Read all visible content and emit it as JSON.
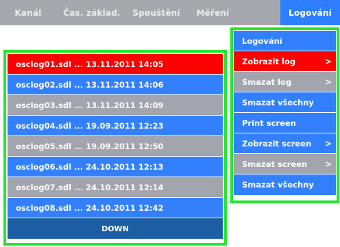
{
  "tabs": [
    {
      "label": "Kanál",
      "active": false
    },
    {
      "label": "Čas. základ.",
      "active": false
    },
    {
      "label": "Spouštění",
      "active": false
    },
    {
      "label": "Měření",
      "active": false
    },
    {
      "label": "Logování",
      "active": true
    }
  ],
  "log_list": {
    "items": [
      {
        "label": "osclog01.sdl ... 13.11.2011 14:05",
        "style": "red"
      },
      {
        "label": "osclog02.sdl ... 13.11.2011 14:06",
        "style": "blue"
      },
      {
        "label": "osclog03.sdl ... 13.11.2011 14:09",
        "style": "gray"
      },
      {
        "label": "osclog04.sdl ... 19.09.2011 12:23",
        "style": "blue"
      },
      {
        "label": "osclog05.sdl ... 19.09.2011 12:50",
        "style": "gray"
      },
      {
        "label": "osclog06.sdl ... 24.10.2011 12:13",
        "style": "blue"
      },
      {
        "label": "osclog07.sdl ... 24.10.2011 12:14",
        "style": "gray"
      },
      {
        "label": "osclog08.sdl ... 24.10.2011 12:42",
        "style": "blue"
      }
    ],
    "down_label": "DOWN"
  },
  "menu": {
    "items": [
      {
        "label": "Logování",
        "style": "blue",
        "chevron": ""
      },
      {
        "label": "Zobrazit log",
        "style": "red",
        "chevron": ">"
      },
      {
        "label": "Smazat log",
        "style": "gray",
        "chevron": ">"
      },
      {
        "label": "Smazat všechny",
        "style": "blue",
        "chevron": ""
      },
      {
        "label": "Print screen",
        "style": "blue",
        "chevron": ""
      },
      {
        "label": "Zobrazit screen",
        "style": "blue",
        "chevron": ">"
      },
      {
        "label": "Smazat screen",
        "style": "gray",
        "chevron": ">"
      },
      {
        "label": "Smazat všechny",
        "style": "blue",
        "chevron": ""
      }
    ]
  },
  "colors": {
    "tab_bar": "#a7a8ad",
    "tab_active": "#2d7fff",
    "row_blue": "#3380ff",
    "row_gray": "#a2a5ad",
    "row_red": "#ff0000",
    "down_button": "#1d5fa4",
    "panel_border": "#23e82d"
  }
}
